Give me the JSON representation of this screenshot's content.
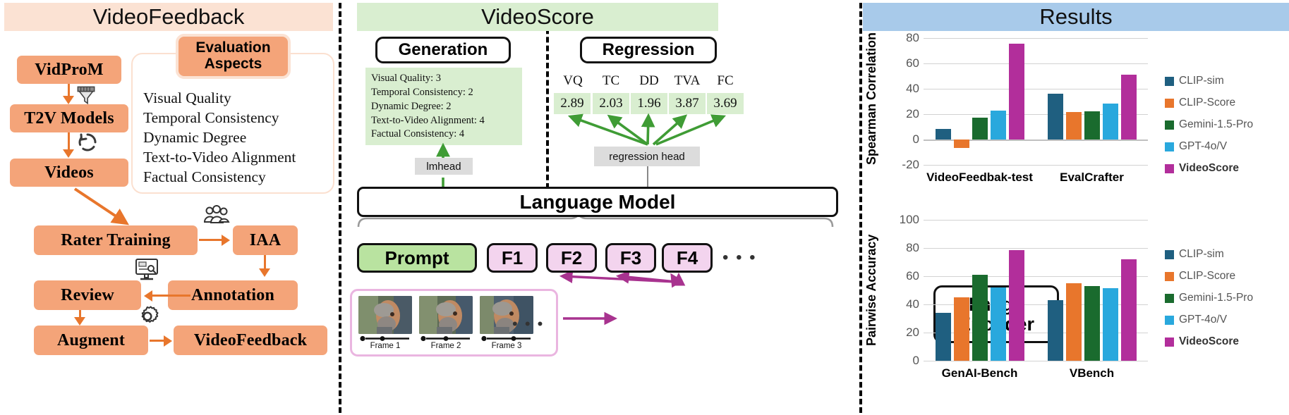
{
  "left": {
    "title": "VideoFeedback",
    "aspects_badge": [
      "Evaluation",
      "Aspects"
    ],
    "aspects": [
      "Visual Quality",
      "Temporal Consistency",
      "Dynamic Degree",
      "Text-to-Video Alignment",
      "Factual Consistency"
    ],
    "nodes": {
      "vidprom": "VidProM",
      "t2v": "T2V Models",
      "videos": "Videos",
      "rater_training": "Rater Training",
      "iaa": "IAA",
      "review": "Review",
      "annotation": "Annotation",
      "augment": "Augment",
      "videofeedback": "VideoFeedback"
    },
    "icons": {
      "filter": "funnel-icon",
      "refresh": "refresh-cycle-icon",
      "people": "people-group-icon",
      "monitor": "monitor-review-icon",
      "gear": "gear-icon"
    }
  },
  "mid": {
    "title": "VideoScore",
    "generation_label": "Generation",
    "regression_label": "Regression",
    "generation_lines": [
      "Visual Quality: 3",
      "Temporal Consistency: 2",
      "Dynamic Degree: 2",
      "Text-to-Video Alignment: 4",
      "Factual Consistency: 4"
    ],
    "score_heads": [
      "VQ",
      "TC",
      "DD",
      "TVA",
      "FC"
    ],
    "score_values": [
      "2.89",
      "2.03",
      "1.96",
      "3.87",
      "3.69"
    ],
    "lmhead": "lmhead",
    "regression_head": "regression head",
    "language_model": "Language Model",
    "tokens": {
      "prompt": "Prompt",
      "frames": [
        "F1",
        "F2",
        "F3",
        "F4"
      ],
      "ellipsis": "• • •"
    },
    "frame_captions": [
      "Frame 1",
      "Frame 2",
      "Frame 3"
    ],
    "frames_ellipsis": "• • •",
    "image_encoder": [
      "Image",
      "Encoder"
    ]
  },
  "right": {
    "title": "Results",
    "chart_data": [
      {
        "type": "bar",
        "title": "",
        "ylabel": "Spearman Correlation",
        "xlabel": "",
        "categories": [
          "VideoFeedbak-test",
          "EvalCrafter"
        ],
        "series": [
          {
            "name": "CLIP-sim",
            "color": "#1f5f80",
            "values": [
              8.5,
              36.0
            ]
          },
          {
            "name": "CLIP-Score",
            "color": "#e8762c",
            "values": [
              -6.5,
              21.5
            ]
          },
          {
            "name": "Gemini-1.5-Pro",
            "color": "#1a6b2e",
            "values": [
              17.0,
              22.5
            ]
          },
          {
            "name": "GPT-4o/V",
            "color": "#29a8dd",
            "values": [
              22.8,
              28.5
            ]
          },
          {
            "name": "VideoScore",
            "color": "#b22e9b",
            "values": [
              75.5,
              51.0
            ]
          }
        ],
        "yticks": [
          80,
          60,
          40,
          20,
          0,
          -20
        ],
        "ylim": [
          -20,
          80
        ],
        "grid": true,
        "legend": "right"
      },
      {
        "type": "bar",
        "title": "",
        "ylabel": "Pairwise Accuracy",
        "xlabel": "",
        "categories": [
          "GenAI-Bench",
          "VBench"
        ],
        "series": [
          {
            "name": "CLIP-sim",
            "color": "#1f5f80",
            "values": [
              34.0,
              43.0
            ]
          },
          {
            "name": "CLIP-Score",
            "color": "#e8762c",
            "values": [
              45.0,
              55.0
            ]
          },
          {
            "name": "Gemini-1.5-Pro",
            "color": "#1a6b2e",
            "values": [
              61.0,
              53.0
            ]
          },
          {
            "name": "GPT-4o/V",
            "color": "#29a8dd",
            "values": [
              52.0,
              51.5
            ]
          },
          {
            "name": "VideoScore",
            "color": "#b22e9b",
            "values": [
              78.5,
              72.0
            ]
          }
        ],
        "yticks": [
          100,
          80,
          60,
          40,
          20,
          0
        ],
        "ylim": [
          0,
          100
        ],
        "grid": true,
        "legend": "right"
      }
    ]
  }
}
